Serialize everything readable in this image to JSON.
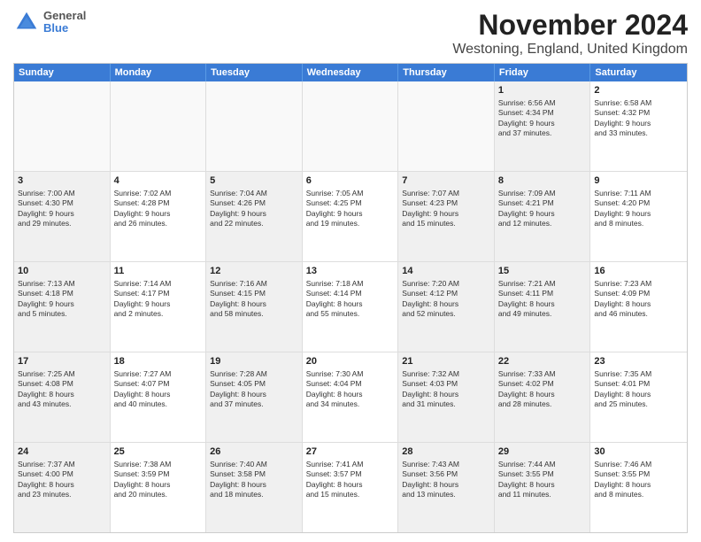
{
  "header": {
    "title": "November 2024",
    "subtitle": "Westoning, England, United Kingdom",
    "logo_general": "General",
    "logo_blue": "Blue"
  },
  "weekdays": [
    "Sunday",
    "Monday",
    "Tuesday",
    "Wednesday",
    "Thursday",
    "Friday",
    "Saturday"
  ],
  "rows": [
    [
      {
        "day": "",
        "info": "",
        "empty": true
      },
      {
        "day": "",
        "info": "",
        "empty": true
      },
      {
        "day": "",
        "info": "",
        "empty": true
      },
      {
        "day": "",
        "info": "",
        "empty": true
      },
      {
        "day": "",
        "info": "",
        "empty": true
      },
      {
        "day": "1",
        "info": "Sunrise: 6:56 AM\nSunset: 4:34 PM\nDaylight: 9 hours\nand 37 minutes.",
        "shaded": true
      },
      {
        "day": "2",
        "info": "Sunrise: 6:58 AM\nSunset: 4:32 PM\nDaylight: 9 hours\nand 33 minutes."
      }
    ],
    [
      {
        "day": "3",
        "info": "Sunrise: 7:00 AM\nSunset: 4:30 PM\nDaylight: 9 hours\nand 29 minutes.",
        "shaded": true
      },
      {
        "day": "4",
        "info": "Sunrise: 7:02 AM\nSunset: 4:28 PM\nDaylight: 9 hours\nand 26 minutes."
      },
      {
        "day": "5",
        "info": "Sunrise: 7:04 AM\nSunset: 4:26 PM\nDaylight: 9 hours\nand 22 minutes.",
        "shaded": true
      },
      {
        "day": "6",
        "info": "Sunrise: 7:05 AM\nSunset: 4:25 PM\nDaylight: 9 hours\nand 19 minutes."
      },
      {
        "day": "7",
        "info": "Sunrise: 7:07 AM\nSunset: 4:23 PM\nDaylight: 9 hours\nand 15 minutes.",
        "shaded": true
      },
      {
        "day": "8",
        "info": "Sunrise: 7:09 AM\nSunset: 4:21 PM\nDaylight: 9 hours\nand 12 minutes.",
        "shaded": true
      },
      {
        "day": "9",
        "info": "Sunrise: 7:11 AM\nSunset: 4:20 PM\nDaylight: 9 hours\nand 8 minutes."
      }
    ],
    [
      {
        "day": "10",
        "info": "Sunrise: 7:13 AM\nSunset: 4:18 PM\nDaylight: 9 hours\nand 5 minutes.",
        "shaded": true
      },
      {
        "day": "11",
        "info": "Sunrise: 7:14 AM\nSunset: 4:17 PM\nDaylight: 9 hours\nand 2 minutes."
      },
      {
        "day": "12",
        "info": "Sunrise: 7:16 AM\nSunset: 4:15 PM\nDaylight: 8 hours\nand 58 minutes.",
        "shaded": true
      },
      {
        "day": "13",
        "info": "Sunrise: 7:18 AM\nSunset: 4:14 PM\nDaylight: 8 hours\nand 55 minutes."
      },
      {
        "day": "14",
        "info": "Sunrise: 7:20 AM\nSunset: 4:12 PM\nDaylight: 8 hours\nand 52 minutes.",
        "shaded": true
      },
      {
        "day": "15",
        "info": "Sunrise: 7:21 AM\nSunset: 4:11 PM\nDaylight: 8 hours\nand 49 minutes.",
        "shaded": true
      },
      {
        "day": "16",
        "info": "Sunrise: 7:23 AM\nSunset: 4:09 PM\nDaylight: 8 hours\nand 46 minutes."
      }
    ],
    [
      {
        "day": "17",
        "info": "Sunrise: 7:25 AM\nSunset: 4:08 PM\nDaylight: 8 hours\nand 43 minutes.",
        "shaded": true
      },
      {
        "day": "18",
        "info": "Sunrise: 7:27 AM\nSunset: 4:07 PM\nDaylight: 8 hours\nand 40 minutes."
      },
      {
        "day": "19",
        "info": "Sunrise: 7:28 AM\nSunset: 4:05 PM\nDaylight: 8 hours\nand 37 minutes.",
        "shaded": true
      },
      {
        "day": "20",
        "info": "Sunrise: 7:30 AM\nSunset: 4:04 PM\nDaylight: 8 hours\nand 34 minutes."
      },
      {
        "day": "21",
        "info": "Sunrise: 7:32 AM\nSunset: 4:03 PM\nDaylight: 8 hours\nand 31 minutes.",
        "shaded": true
      },
      {
        "day": "22",
        "info": "Sunrise: 7:33 AM\nSunset: 4:02 PM\nDaylight: 8 hours\nand 28 minutes.",
        "shaded": true
      },
      {
        "day": "23",
        "info": "Sunrise: 7:35 AM\nSunset: 4:01 PM\nDaylight: 8 hours\nand 25 minutes."
      }
    ],
    [
      {
        "day": "24",
        "info": "Sunrise: 7:37 AM\nSunset: 4:00 PM\nDaylight: 8 hours\nand 23 minutes.",
        "shaded": true
      },
      {
        "day": "25",
        "info": "Sunrise: 7:38 AM\nSunset: 3:59 PM\nDaylight: 8 hours\nand 20 minutes."
      },
      {
        "day": "26",
        "info": "Sunrise: 7:40 AM\nSunset: 3:58 PM\nDaylight: 8 hours\nand 18 minutes.",
        "shaded": true
      },
      {
        "day": "27",
        "info": "Sunrise: 7:41 AM\nSunset: 3:57 PM\nDaylight: 8 hours\nand 15 minutes."
      },
      {
        "day": "28",
        "info": "Sunrise: 7:43 AM\nSunset: 3:56 PM\nDaylight: 8 hours\nand 13 minutes.",
        "shaded": true
      },
      {
        "day": "29",
        "info": "Sunrise: 7:44 AM\nSunset: 3:55 PM\nDaylight: 8 hours\nand 11 minutes.",
        "shaded": true
      },
      {
        "day": "30",
        "info": "Sunrise: 7:46 AM\nSunset: 3:55 PM\nDaylight: 8 hours\nand 8 minutes."
      }
    ]
  ]
}
